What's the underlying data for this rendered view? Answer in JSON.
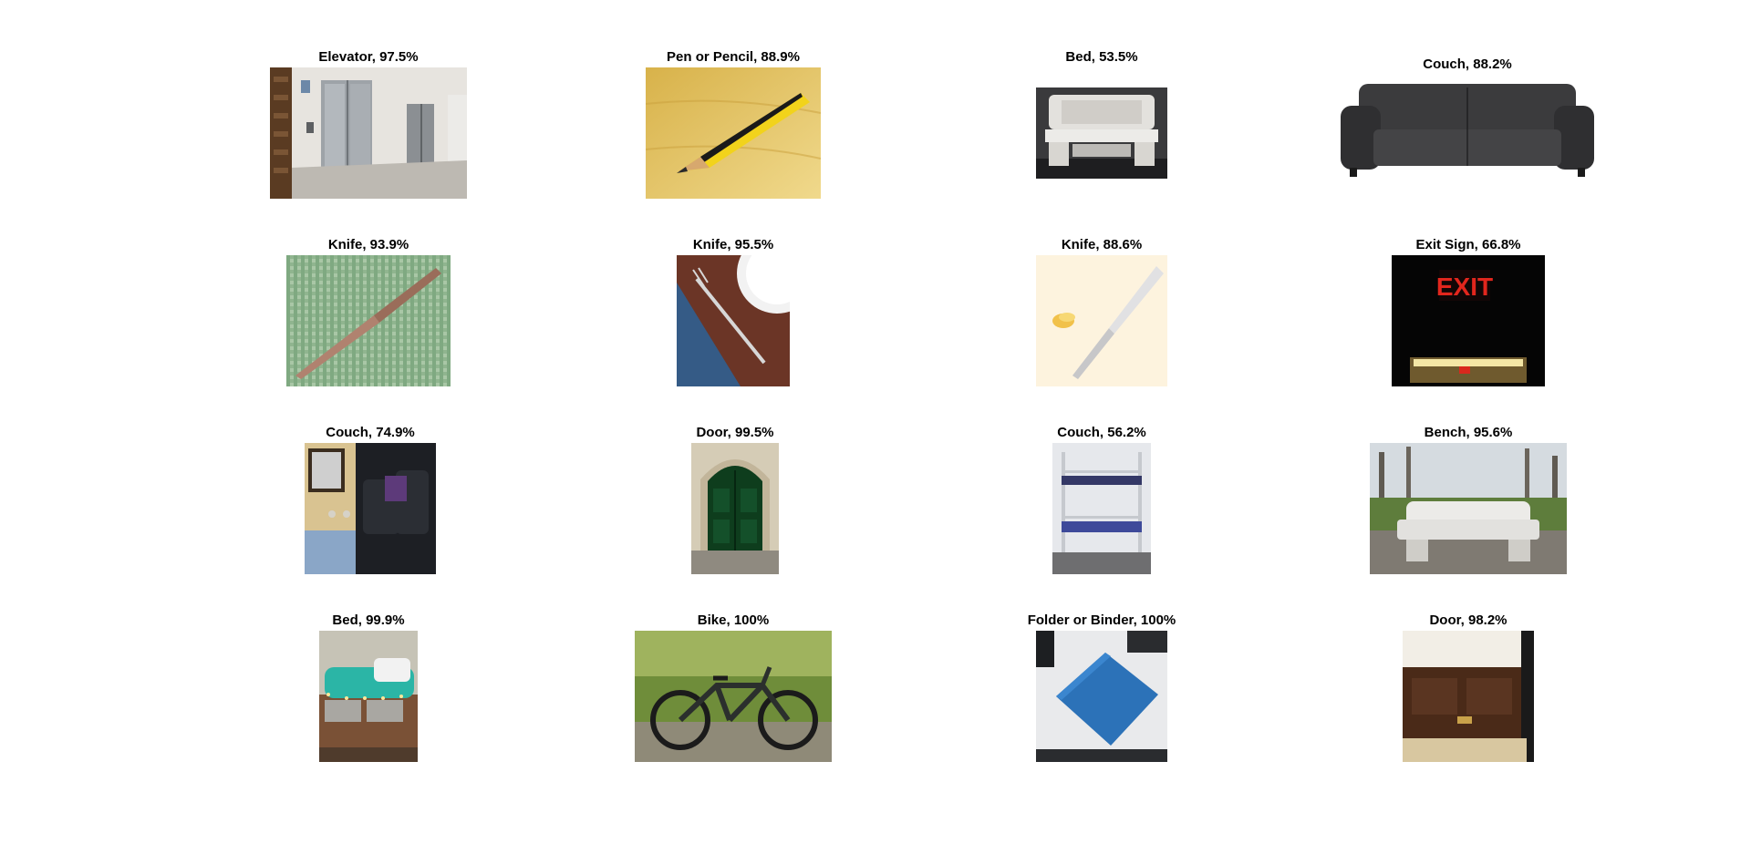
{
  "figure": {
    "background": "#ffffff",
    "panels": [
      {
        "label": "Elevator, 97.5%",
        "icon": "elevator-photo"
      },
      {
        "label": "Pen or Pencil, 88.9%",
        "icon": "pencil-photo"
      },
      {
        "label": "Bed, 53.5%",
        "icon": "stone-bench-photo"
      },
      {
        "label": "Couch, 88.2%",
        "icon": "leather-couch-photo"
      },
      {
        "label": "Knife, 93.9%",
        "icon": "knife-on-cloth-photo"
      },
      {
        "label": "Knife, 95.5%",
        "icon": "fork-and-plate-photo"
      },
      {
        "label": "Knife, 88.6%",
        "icon": "butter-knife-photo"
      },
      {
        "label": "Exit Sign, 66.8%",
        "icon": "exit-sign-photo"
      },
      {
        "label": "Couch, 74.9%",
        "icon": "living-room-couch-photo"
      },
      {
        "label": "Door, 99.5%",
        "icon": "green-door-photo"
      },
      {
        "label": "Couch, 56.2%",
        "icon": "bunk-bed-photo"
      },
      {
        "label": "Bench, 95.6%",
        "icon": "park-bench-photo"
      },
      {
        "label": "Bed, 99.9%",
        "icon": "dorm-bed-photo"
      },
      {
        "label": "Bike, 100%",
        "icon": "bike-photo"
      },
      {
        "label": "Folder or Binder, 100%",
        "icon": "blue-folder-photo"
      },
      {
        "label": "Door, 98.2%",
        "icon": "wooden-door-photo"
      }
    ]
  }
}
